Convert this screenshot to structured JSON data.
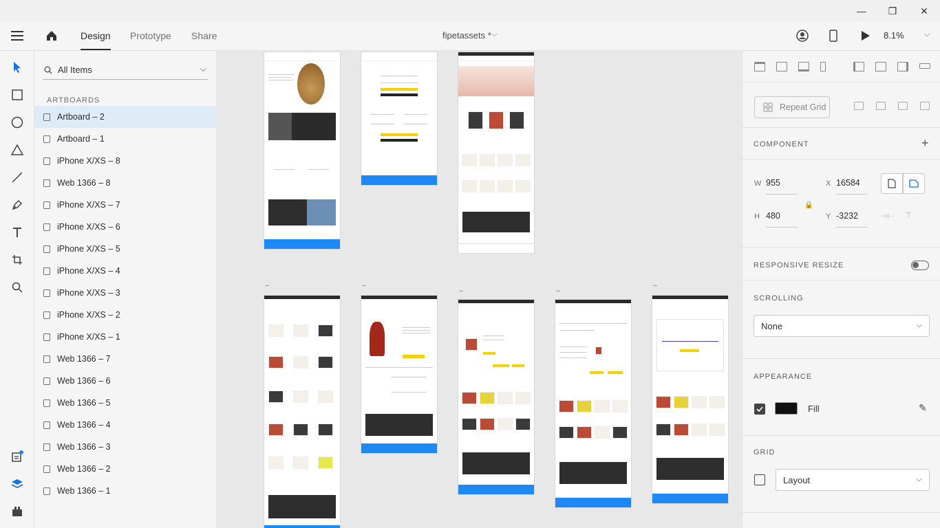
{
  "window": {
    "minimize": "—",
    "restore": "❐",
    "close": "✕"
  },
  "header": {
    "tabs": [
      {
        "label": "Design",
        "active": true
      },
      {
        "label": "Prototype"
      },
      {
        "label": "Share"
      }
    ],
    "doc_title": "fipetassets *",
    "zoom": "8.1%"
  },
  "layers": {
    "search_placeholder": "All Items",
    "section_label": "ARTBOARDS",
    "items": [
      "Artboard – 2",
      "Artboard – 1",
      "iPhone X/XS – 8",
      "Web 1366 – 8",
      "iPhone X/XS – 7",
      "iPhone X/XS – 6",
      "iPhone X/XS – 5",
      "iPhone X/XS – 4",
      "iPhone X/XS – 3",
      "iPhone X/XS – 2",
      "iPhone X/XS – 1",
      "Web 1366 – 7",
      "Web 1366 – 6",
      "Web 1366 – 5",
      "Web 1366 – 4",
      "Web 1366 – 3",
      "Web 1366 – 2",
      "Web 1366 – 1"
    ],
    "selected_index": 0
  },
  "canvas": {
    "artboard_menu": "..."
  },
  "properties": {
    "repeat_grid": "Repeat Grid",
    "component_label": "COMPONENT",
    "add_symbol": "+",
    "w_label": "W",
    "w_value": "955",
    "x_label": "X",
    "x_value": "16584",
    "h_label": "H",
    "h_value": "480",
    "y_label": "Y",
    "y_value": "-3232",
    "responsive_label": "RESPONSIVE RESIZE",
    "scrolling_label": "SCROLLING",
    "scrolling_value": "None",
    "appearance_label": "APPEARANCE",
    "fill_label": "Fill",
    "fill_color": "#111111",
    "grid_label": "GRID",
    "grid_value": "Layout"
  },
  "colors": {
    "accent": "#1e88f5",
    "selection": "#deebf7",
    "dark": "#2e2e2e",
    "yellow": "#f5d000"
  }
}
